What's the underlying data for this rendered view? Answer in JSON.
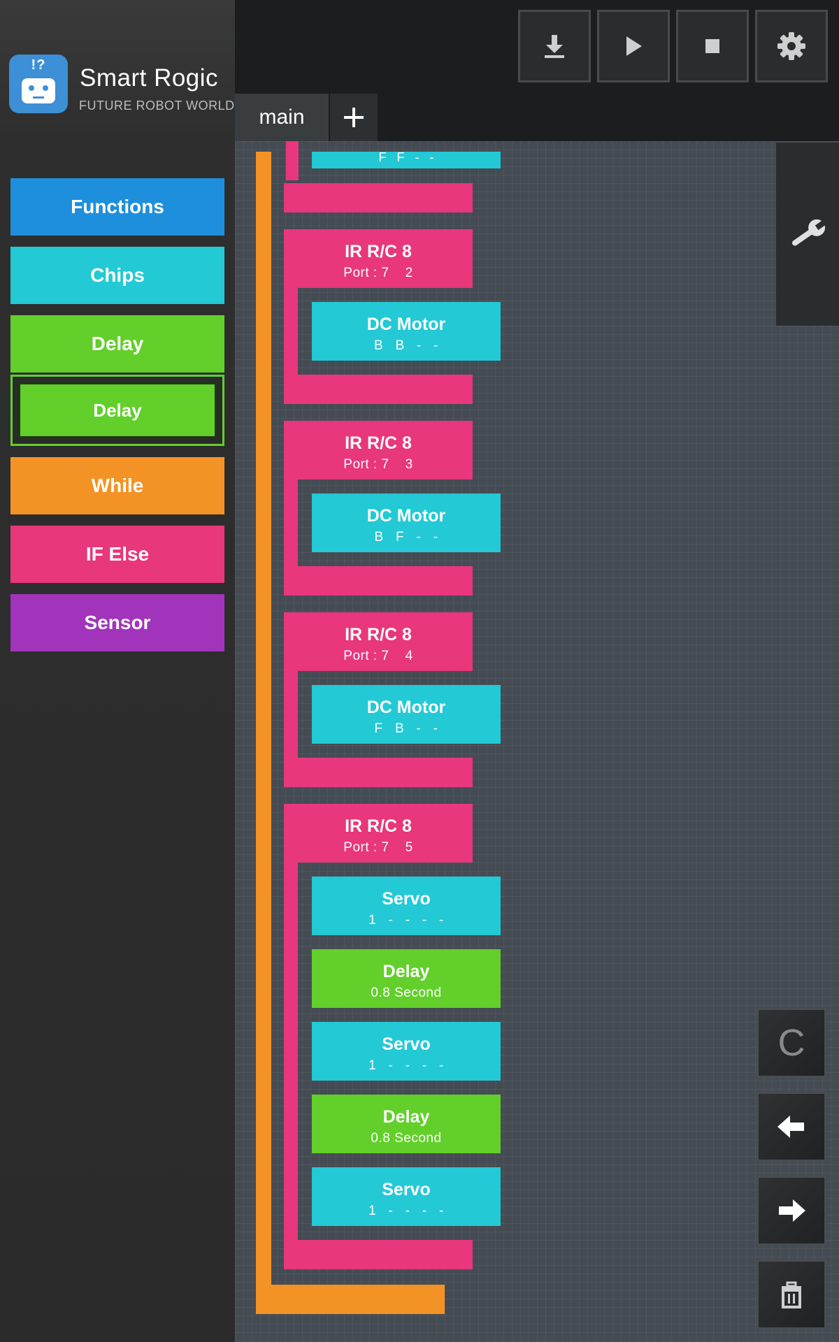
{
  "app": {
    "logo_marks": "!?",
    "title": "Smart Rogic",
    "subtitle": "FUTURE ROBOT WORLD"
  },
  "categories": [
    {
      "label": "Functions",
      "color": "#1e8fdc"
    },
    {
      "label": "Chips",
      "color": "#23c9d4"
    },
    {
      "label": "Delay",
      "color": "#62cf2b"
    },
    {
      "label": "While",
      "color": "#f39325"
    },
    {
      "label": "IF Else",
      "color": "#e8377a"
    },
    {
      "label": "Sensor",
      "color": "#a134bb"
    }
  ],
  "selected_block": {
    "label": "Delay"
  },
  "toolbar": {
    "icons": [
      "download-icon",
      "play-icon",
      "stop-icon",
      "gear-icon"
    ]
  },
  "tabs": {
    "active": "main",
    "add_icon": "plus-icon"
  },
  "canvas": {
    "partial_top_block": {
      "sub": "F   F   -   -"
    },
    "if_blocks": [
      {
        "title": "IR R/C 8",
        "sub": "Port : 7    2",
        "children": [
          {
            "kind": "motor",
            "title": "DC Motor",
            "sub": "B   B   -   -"
          }
        ]
      },
      {
        "title": "IR R/C 8",
        "sub": "Port : 7    3",
        "children": [
          {
            "kind": "motor",
            "title": "DC Motor",
            "sub": "B   F   -   -"
          }
        ]
      },
      {
        "title": "IR R/C 8",
        "sub": "Port : 7    4",
        "children": [
          {
            "kind": "motor",
            "title": "DC Motor",
            "sub": "F   B   -   -"
          }
        ]
      },
      {
        "title": "IR R/C 8",
        "sub": "Port : 7    5",
        "children": [
          {
            "kind": "servo",
            "title": "Servo",
            "sub": "1   -   -   -   -"
          },
          {
            "kind": "delay",
            "title": "Delay",
            "sub": "0.8 Second"
          },
          {
            "kind": "servo",
            "title": "Servo",
            "sub": "1   -   -   -   -"
          },
          {
            "kind": "delay",
            "title": "Delay",
            "sub": "0.8 Second"
          },
          {
            "kind": "servo",
            "title": "Servo",
            "sub": "1   -   -   -   -"
          }
        ]
      }
    ]
  },
  "side_tools": {
    "wrench": "wrench-icon",
    "clear_label": "C",
    "undo": "arrow-left-icon",
    "redo": "arrow-right-icon",
    "delete": "trash-icon"
  }
}
